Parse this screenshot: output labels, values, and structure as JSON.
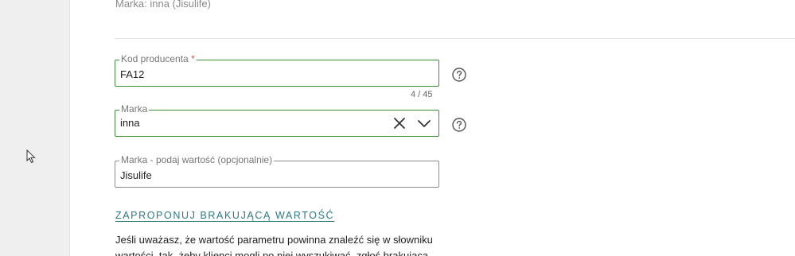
{
  "summary": {
    "brand_text": "Marka: inna (Jisulife)"
  },
  "producer_code": {
    "label": "Kod producenta",
    "required_mark": "*",
    "value": "FA12",
    "counter": "4  /  45"
  },
  "brand_select": {
    "label": "Marka",
    "value": "inna"
  },
  "brand_custom": {
    "label": "Marka - podaj wartość (opcjonalnie)",
    "value": "Jisulife"
  },
  "suggest_link": {
    "label": "ZAPROPONUJ BRAKUJĄCĄ WARTOŚĆ"
  },
  "info_text": "Jeśli uważasz, że wartość parametru powinna znaleźć się w słowniku wartości, tak, żeby klienci mogli po niej wyszukiwać, zgłoś brakującą",
  "colors": {
    "valid_border": "#3f8f3a",
    "link": "#2b7a84",
    "required": "#d9534f"
  },
  "icons": [
    "help-icon",
    "clear-icon",
    "chevron-down-icon",
    "mouse-cursor-icon"
  ]
}
